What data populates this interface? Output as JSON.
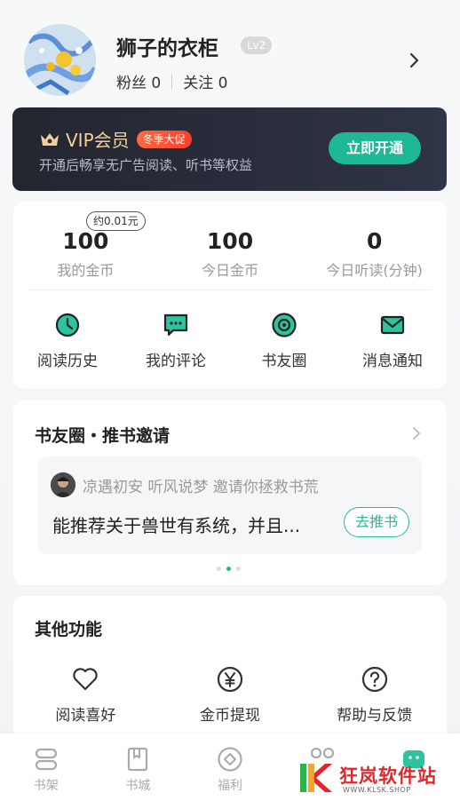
{
  "profile": {
    "username": "狮子的衣柜",
    "level": "Lv2",
    "fans_label": "粉丝",
    "fans_count": "0",
    "following_label": "关注",
    "following_count": "0"
  },
  "vip": {
    "title": "VIP会员",
    "promo": "冬季大促",
    "subtitle": "开通后畅享无广告阅读、听书等权益",
    "button": "立即开通",
    "accent": "#f4cf9a"
  },
  "stats": {
    "coin_tip": "约0.01元",
    "items": [
      {
        "value": "100",
        "label": "我的金币"
      },
      {
        "value": "100",
        "label": "今日金币"
      },
      {
        "value": "0",
        "label": "今日听读(分钟)"
      }
    ]
  },
  "shortcuts": [
    {
      "label": "阅读历史",
      "icon": "clock-icon"
    },
    {
      "label": "我的评论",
      "icon": "comment-icon"
    },
    {
      "label": "书友圈",
      "icon": "circle-icon"
    },
    {
      "label": "消息通知",
      "icon": "mail-icon"
    }
  ],
  "circle": {
    "title": "书友圈・推书邀请",
    "invite_text": "凉遇初安  听风说梦 邀请你拯救书荒",
    "book_text": "能推荐关于兽世有系统，并且...",
    "button": "去推书"
  },
  "other": {
    "title": "其他功能",
    "items": [
      {
        "label": "阅读喜好",
        "icon": "heart-icon"
      },
      {
        "label": "金币提现",
        "icon": "yen-icon"
      },
      {
        "label": "帮助与反馈",
        "icon": "help-icon"
      }
    ]
  },
  "tabbar": [
    {
      "label": "书架",
      "icon": "bookshelf-icon"
    },
    {
      "label": "书城",
      "icon": "book-icon"
    },
    {
      "label": "福利",
      "icon": "gift-icon"
    },
    {
      "label": "",
      "icon": "community-icon"
    },
    {
      "label": "",
      "icon": "profile-icon"
    }
  ],
  "watermark": {
    "text": "狂岚软件站",
    "url": "WWW.KLSK.SHOP"
  },
  "colors": {
    "brand": "#1fb896",
    "promo": "#ff4d31"
  }
}
